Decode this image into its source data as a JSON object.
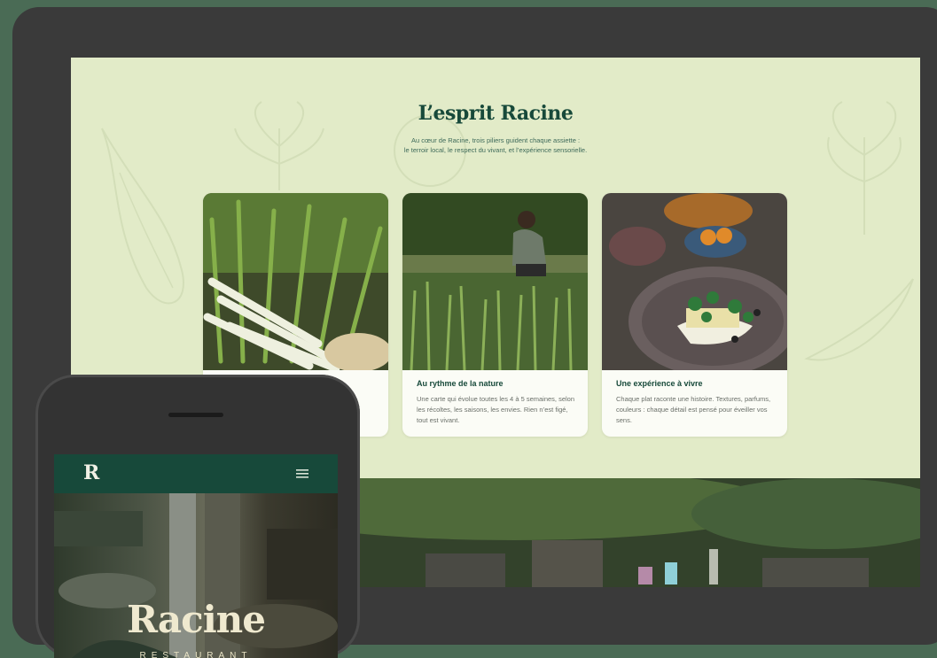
{
  "section": {
    "title": "L’esprit Racine",
    "intro_line1": "Au cœur de Racine, trois piliers guident chaque assiette :",
    "intro_line2": "le terroir local, le respect du vivant, et l’expérience sensorielle."
  },
  "cards": [
    {
      "title": "",
      "desc": ""
    },
    {
      "title": "Au rythme de la nature",
      "desc": "Une carte qui évolue toutes les 4 à 5 semaines, selon les récoltes, les saisons, les envies. Rien n’est figé, tout est vivant."
    },
    {
      "title": "Une expérience à vivre",
      "desc": "Chaque plat raconte une histoire. Textures, parfums, couleurs : chaque détail est pensé pour éveiller vos sens."
    }
  ],
  "phone": {
    "logo": "R",
    "hero_title": "Racine",
    "hero_subtitle": "RESTAURANT"
  },
  "icons": {
    "menu": "hamburger-menu-icon"
  },
  "colors": {
    "brand_green": "#17493a",
    "cream_bg": "#e2ebc8",
    "outer_bg": "#4a6b55"
  }
}
